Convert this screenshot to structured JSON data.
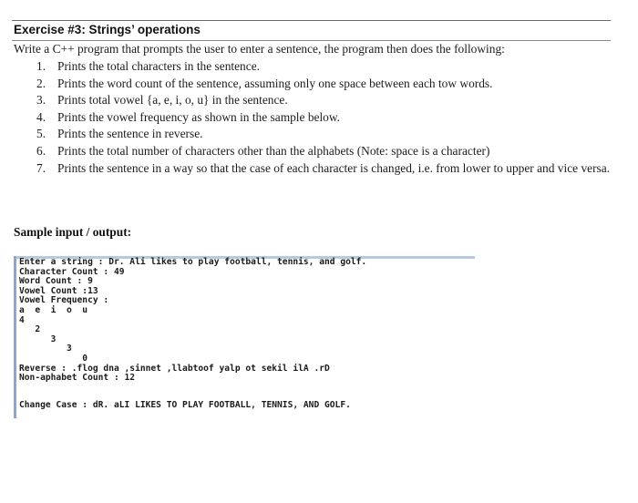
{
  "exercise": {
    "title": "Exercise #3: Strings’ operations",
    "intro": "Write a C++ program that prompts the user to enter a sentence, the program then does the following:",
    "tasks": [
      {
        "number": "1.",
        "text": "Prints the total characters in the sentence."
      },
      {
        "number": "2.",
        "text": "Prints the word count of the sentence, assuming only one space between each tow words."
      },
      {
        "number": "3.",
        "text": "Prints total vowel {a, e, i, o, u} in the sentence."
      },
      {
        "number": "4.",
        "text": "Prints the vowel frequency as shown in the sample below."
      },
      {
        "number": "5.",
        "text": "Prints the sentence in reverse."
      },
      {
        "number": "6.",
        "text": "Prints the total number of characters other than the alphabets (Note: space is a character)"
      },
      {
        "number": "7.",
        "text": "Prints the sentence in a way so that the case of each character is changed, i.e. from lower to upper and vice versa."
      }
    ]
  },
  "sample": {
    "heading": "Sample input / output:",
    "console_lines": [
      "Enter a string : Dr. Ali likes to play football, tennis, and golf.",
      "Character Count : 49",
      "Word Count : 9",
      "Vowel Count :13",
      "Vowel Frequency :",
      "a  e  i  o  u",
      "4",
      "   2",
      "      3",
      "         3",
      "            0",
      "Reverse : .flog dna ,sinnet ,llabtoof yalp ot sekil ilA .rD",
      "Non-aphabet Count : 12"
    ],
    "change_case_line": "Change Case : dR. aLI LIKES TO PLAY FOOTBALL, TENNIS, AND GOLF."
  }
}
